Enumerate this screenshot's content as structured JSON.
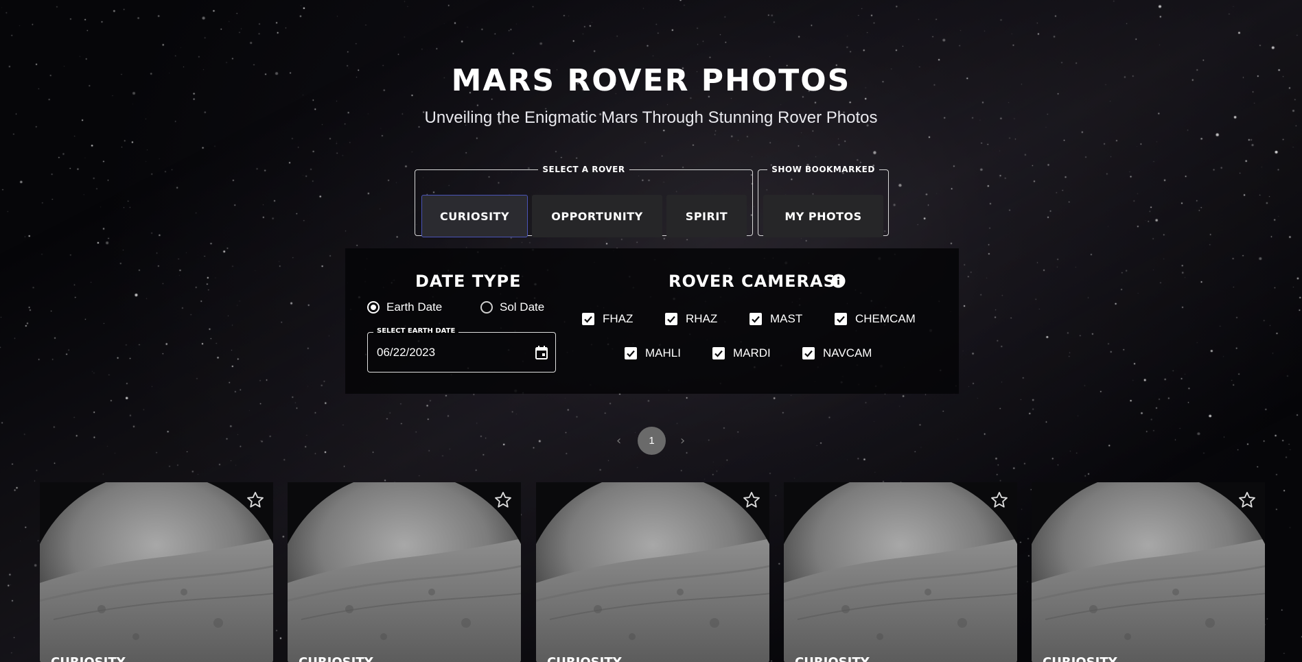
{
  "header": {
    "title": "Mars Rover Photos",
    "subtitle": "Unveiling the Enigmatic Mars Through Stunning Rover Photos"
  },
  "rover_select": {
    "legend": "Select a Rover",
    "rovers": [
      "Curiosity",
      "Opportunity",
      "Spirit"
    ],
    "selected": "Curiosity"
  },
  "bookmarks": {
    "legend": "Show Bookmarked",
    "button_label": "My Photos"
  },
  "date_type": {
    "title": "Date Type",
    "options": [
      "Earth Date",
      "Sol Date"
    ],
    "selected": "Earth Date",
    "field_label": "Select Earth Date",
    "field_value": "06/22/2023"
  },
  "cameras": {
    "title": "Rover Cameras",
    "items": [
      {
        "label": "FHAZ",
        "checked": true
      },
      {
        "label": "RHAZ",
        "checked": true
      },
      {
        "label": "MAST",
        "checked": true
      },
      {
        "label": "CHEMCAM",
        "checked": true
      },
      {
        "label": "MAHLI",
        "checked": true
      },
      {
        "label": "MARDI",
        "checked": true
      },
      {
        "label": "NAVCAM",
        "checked": true
      }
    ]
  },
  "pagination": {
    "current_page": "1",
    "prev_icon": "chevron-left-icon",
    "next_icon": "chevron-right-icon"
  },
  "photos": [
    {
      "rover": "Curiosity",
      "bookmarked": false
    },
    {
      "rover": "Curiosity",
      "bookmarked": false
    },
    {
      "rover": "Curiosity",
      "bookmarked": false
    },
    {
      "rover": "Curiosity",
      "bookmarked": false
    },
    {
      "rover": "Curiosity",
      "bookmarked": false
    }
  ],
  "colors": {
    "active_border": "#4a54b8",
    "button_bg": "#262628",
    "page_dot": "#6a6a6a"
  }
}
